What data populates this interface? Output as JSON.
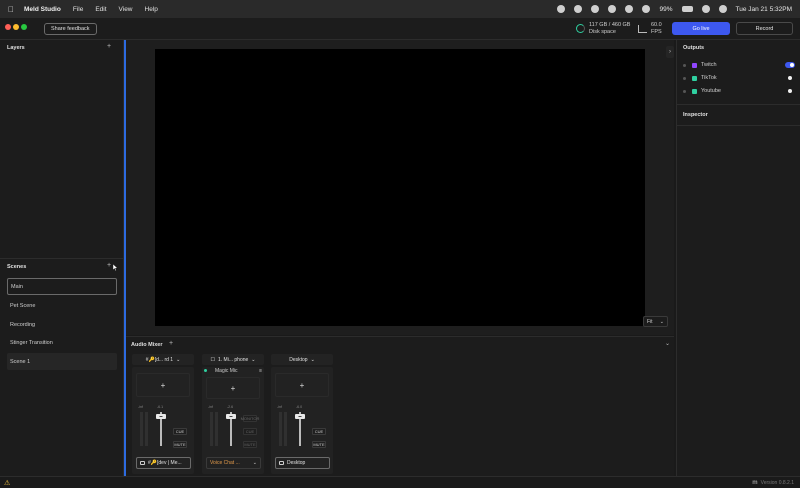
{
  "menubar": {
    "app_name": "Meld Studio",
    "menus": [
      "File",
      "Edit",
      "View",
      "Help"
    ],
    "battery": "99%",
    "clock": "Tue Jan 21  5:32PM"
  },
  "toolbar": {
    "share_feedback": "Share feedback",
    "disk_usage": "117 GB / 460 GB",
    "disk_label": "Disk space",
    "fps_value": "60.0",
    "fps_label": "FPS",
    "go_live": "Go live",
    "record": "Record"
  },
  "layers": {
    "title": "Layers"
  },
  "scenes": {
    "title": "Scenes",
    "items": [
      "Main",
      "Pet Scene",
      "Recording",
      "Stinger Transition",
      "Scene 1"
    ]
  },
  "preview": {
    "fit_label": "Fit"
  },
  "outputs": {
    "title": "Outputs",
    "items": [
      {
        "label": "Twitch",
        "color": "#9146ff"
      },
      {
        "label": "TikTok",
        "color": "#2fd0a0"
      },
      {
        "label": "Youtube",
        "color": "#2fd0a0"
      }
    ]
  },
  "inspector": {
    "title": "Inspector"
  },
  "audio_mixer": {
    "title": "Audio Mixer",
    "tracks": [
      {
        "name": "#🔑[d... rd 1",
        "db": "-6.1",
        "level_db": "-inf",
        "cue": "CUE",
        "mute": "MUTE",
        "footer": "#🔑[dev | Me..."
      },
      {
        "name": "1. Mi... phone",
        "filter": "Magic Mic",
        "db": "-2.6",
        "level_db": "-inf",
        "cue": "CUE",
        "mute": "MUTE",
        "monitor": "MONITOR",
        "footer": "Voice Chat ..."
      },
      {
        "name": "Desktop",
        "db": "-6.0",
        "level_db": "-inf",
        "cue": "CUE",
        "mute": "MUTE",
        "footer": "Desktop"
      }
    ]
  },
  "status": {
    "version": "Version 0.8.2.1"
  }
}
